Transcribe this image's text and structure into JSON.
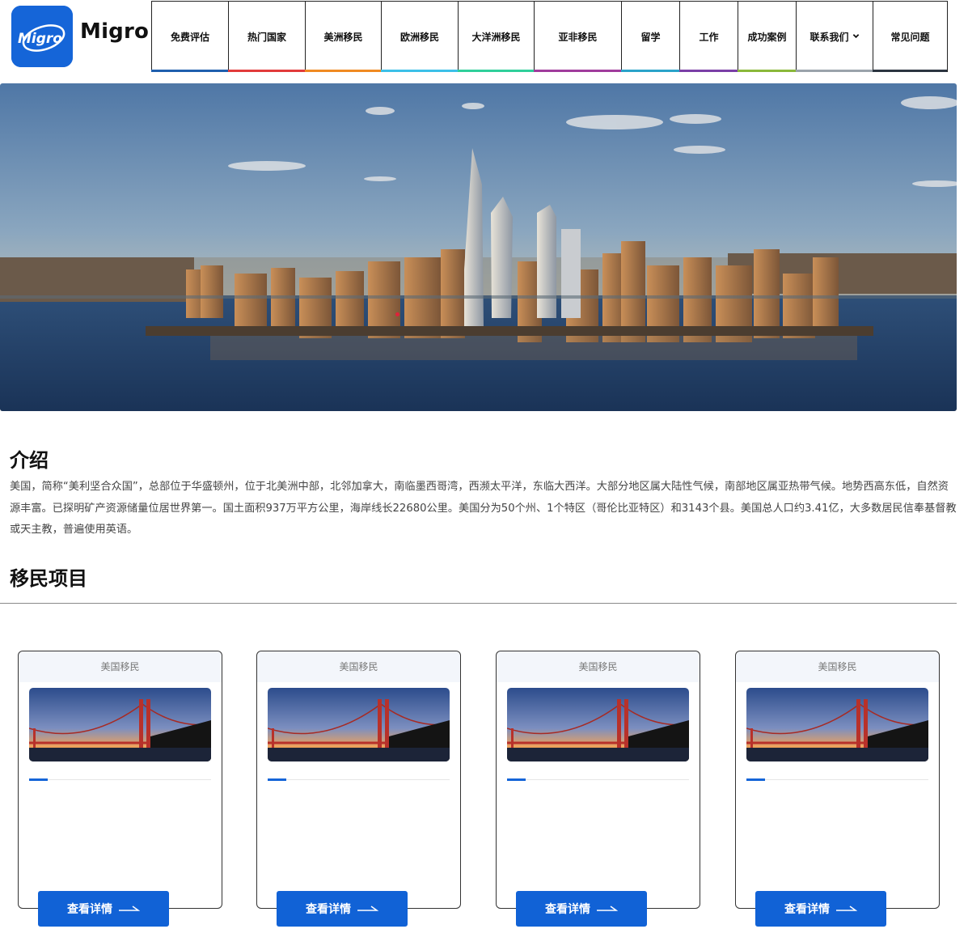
{
  "brand": {
    "name": "Migro",
    "logo_text": "Migro"
  },
  "nav": {
    "items": [
      {
        "label": "免费评估",
        "accent": "#1f5fae"
      },
      {
        "label": "热门国家",
        "accent": "#e23b3b"
      },
      {
        "label": "美洲移民",
        "accent": "#f08a22"
      },
      {
        "label": "欧洲移民",
        "accent": "#3cc0e8"
      },
      {
        "label": "大洋洲移民",
        "accent": "#2fcf9a"
      },
      {
        "label": "亚非移民",
        "accent": "#a03c9c"
      },
      {
        "label": "留学",
        "accent": "#2aa3c9"
      },
      {
        "label": "工作",
        "accent": "#7a3fa6"
      },
      {
        "label": "成功案例",
        "accent": "#8ab83a"
      },
      {
        "label": "联系我们",
        "accent": "#9aa3ab",
        "has_dropdown": true,
        "icon": "chevron-down-icon"
      },
      {
        "label": "常见问题",
        "accent": "#2b3440"
      }
    ]
  },
  "intro": {
    "title": "介绍",
    "text": "美国，简称“美利坚合众国”，总部位于华盛顿州，位于北美洲中部，北邻加拿大，南临墨西哥湾，西濒太平洋，东临大西洋。大部分地区属大陆性气候，南部地区属亚热带气候。地势西高东低，自然资源丰富。已探明矿产资源储量位居世界第一。国土面积937万平方公里，海岸线长22680公里。美国分为50个州、1个特区（哥伦比亚特区）和3143个县。美国总人口约3.41亿，大多数居民信奉基督教或天主教，普遍使用英语。"
  },
  "projects": {
    "title": "移民项目",
    "cards": [
      {
        "category": "美国移民",
        "button": "查看详情"
      },
      {
        "category": "美国移民",
        "button": "查看详情"
      },
      {
        "category": "美国移民",
        "button": "查看详情"
      },
      {
        "category": "美国移民",
        "button": "查看详情"
      }
    ]
  },
  "colors": {
    "brand_blue": "#1565d8",
    "button_blue": "#1162d6"
  }
}
